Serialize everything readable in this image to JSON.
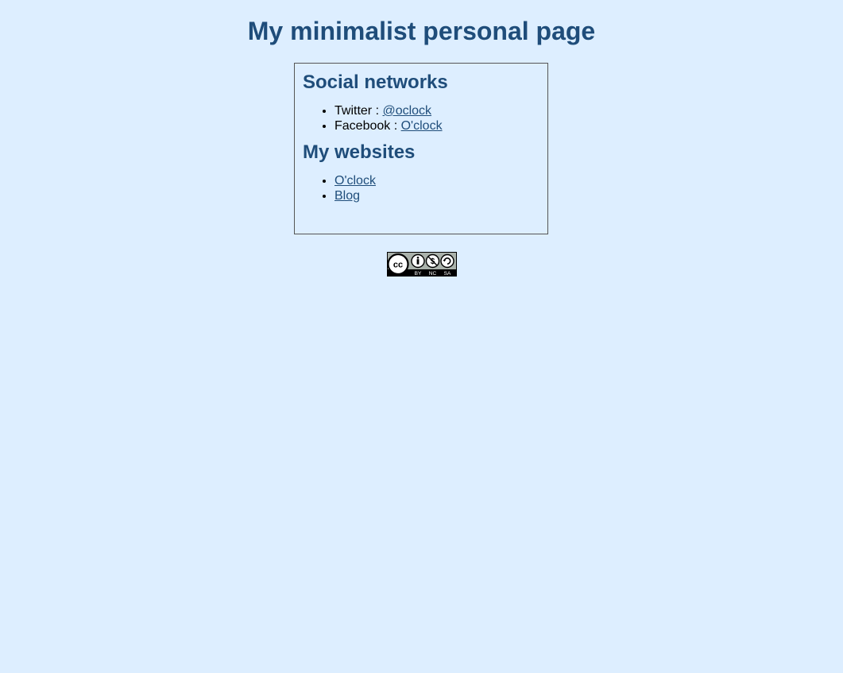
{
  "page": {
    "title": "My minimalist personal page"
  },
  "social": {
    "heading": "Social networks",
    "items": [
      {
        "label": "Twitter : ",
        "link": "@oclock"
      },
      {
        "label": "Facebook : ",
        "link": "O'clock"
      }
    ]
  },
  "websites": {
    "heading": "My websites",
    "items": [
      {
        "link": "O'clock"
      },
      {
        "link": "Blog"
      }
    ]
  },
  "license": {
    "badge_parts": [
      "BY",
      "NC",
      "SA"
    ],
    "icon": "creative-commons-by-nc-sa-badge"
  },
  "colors": {
    "background": "#ddeeff",
    "heading": "#1f4d7a",
    "link": "#1f4d7a"
  }
}
